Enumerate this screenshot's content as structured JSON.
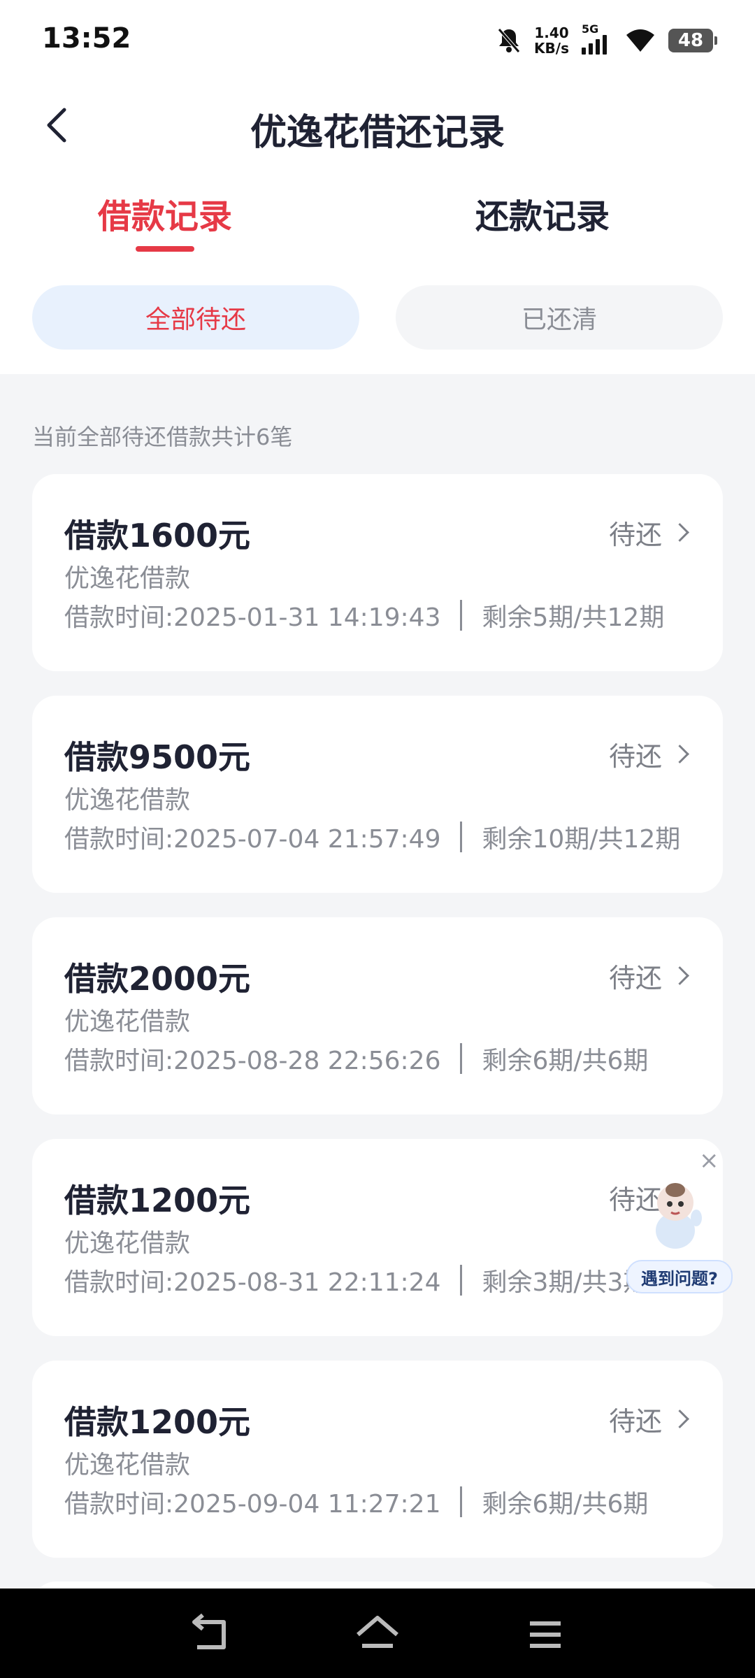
{
  "status_bar": {
    "time": "13:52",
    "net_speed_value": "1.40",
    "net_speed_unit": "KB/s",
    "network": "5G",
    "battery": "48",
    "icons": [
      "bell-muted-icon",
      "signal-5g-icon",
      "wifi-icon",
      "battery-icon"
    ]
  },
  "header": {
    "title": "优逸花借还记录",
    "back_icon": "chevron-left-icon"
  },
  "tabs": [
    {
      "label": "借款记录",
      "active": true
    },
    {
      "label": "还款记录",
      "active": false
    }
  ],
  "filters": [
    {
      "label": "全部待还",
      "active": true
    },
    {
      "label": "已还清",
      "active": false
    }
  ],
  "summary": "当前全部待还借款共计6笔",
  "loans": [
    {
      "amount": "借款1600元",
      "status": "待还",
      "product": "优逸花借款",
      "time": "借款时间:2025-01-31 14:19:43",
      "periods": "剩余5期/共12期"
    },
    {
      "amount": "借款9500元",
      "status": "待还",
      "product": "优逸花借款",
      "time": "借款时间:2025-07-04 21:57:49",
      "periods": "剩余10期/共12期"
    },
    {
      "amount": "借款2000元",
      "status": "待还",
      "product": "优逸花借款",
      "time": "借款时间:2025-08-28 22:56:26",
      "periods": "剩余6期/共6期"
    },
    {
      "amount": "借款1200元",
      "status": "待还",
      "product": "优逸花借款",
      "time": "借款时间:2025-08-31 22:11:24",
      "periods": "剩余3期/共3期"
    },
    {
      "amount": "借款1200元",
      "status": "待还",
      "product": "优逸花借款",
      "time": "借款时间:2025-09-04 11:27:21",
      "periods": "剩余6期/共6期"
    }
  ],
  "floating_help": {
    "label": "遇到问题?",
    "close": "×"
  },
  "colors": {
    "accent": "#e63946",
    "title": "#1f2233",
    "muted": "#8a8d95",
    "page_bg": "#f4f5f7",
    "active_filter_bg": "#e8f1fd"
  },
  "nav_icons": [
    "back-nav-icon",
    "home-nav-icon",
    "menu-nav-icon"
  ]
}
